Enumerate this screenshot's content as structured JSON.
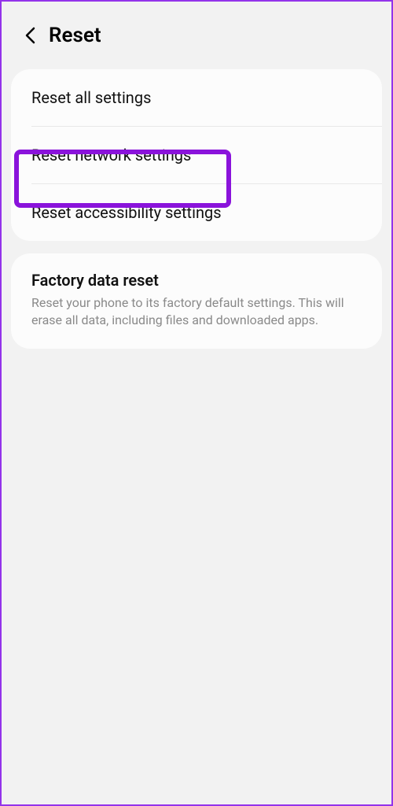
{
  "header": {
    "title": "Reset"
  },
  "group1": {
    "item1": "Reset all settings",
    "item2": "Reset network settings",
    "item3": "Reset accessibility settings"
  },
  "group2": {
    "title": "Factory data reset",
    "desc": "Reset your phone to its factory default settings. This will erase all data, including files and downloaded apps."
  },
  "colors": {
    "highlight": "#8a13db",
    "border": "#9333ea"
  }
}
